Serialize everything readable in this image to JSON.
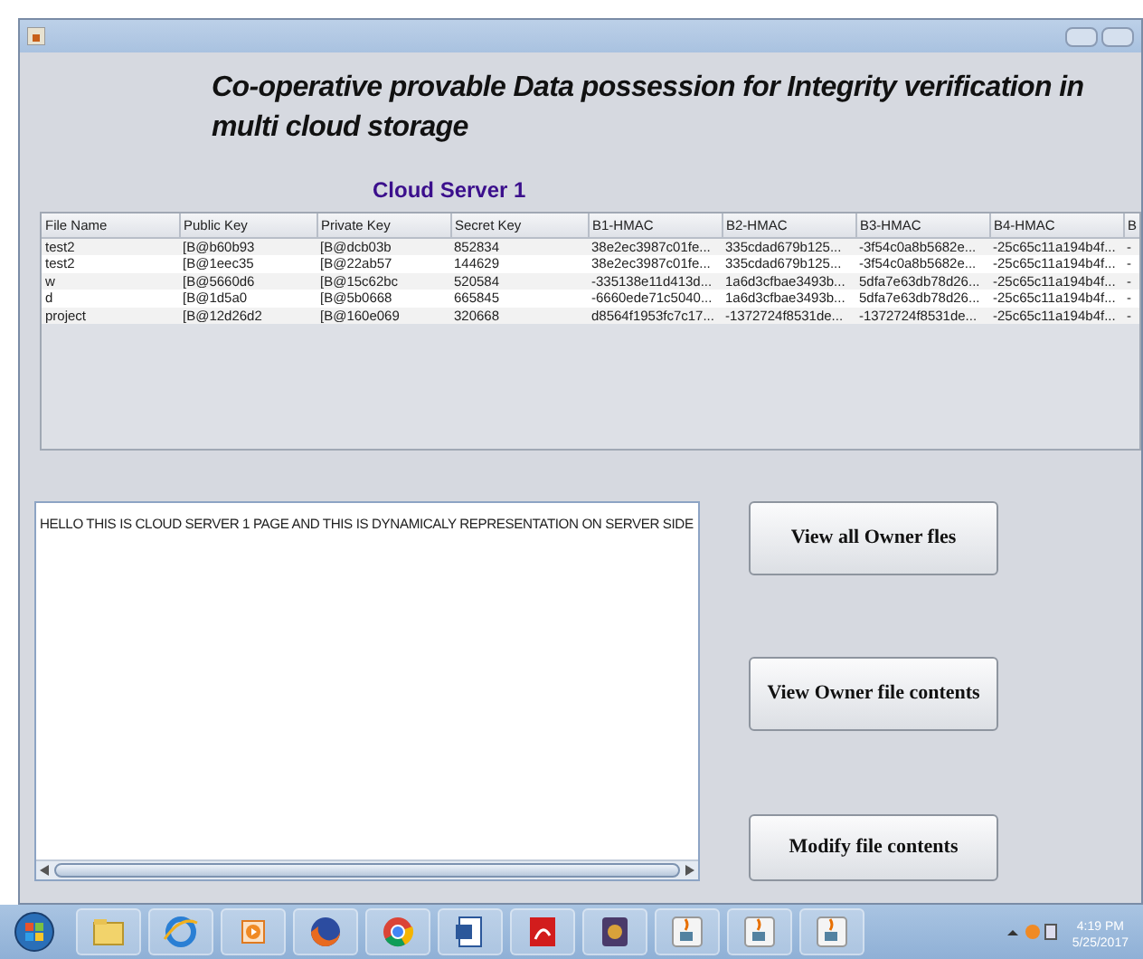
{
  "window": {
    "title_text": "Co-operative provable Data possession for Integrity verification in multi cloud storage"
  },
  "heading": "Cloud Server 1",
  "table": {
    "columns": [
      "File Name",
      "Public Key",
      "Private Key",
      "Secret Key",
      "B1-HMAC",
      "B2-HMAC",
      "B3-HMAC",
      "B4-HMAC",
      "B"
    ],
    "rows": [
      [
        "test2",
        "[B@b60b93",
        "[B@dcb03b",
        "852834",
        "38e2ec3987c01fe...",
        "335cdad679b125...",
        "-3f54c0a8b5682e...",
        "-25c65c11a194b4f...",
        "-"
      ],
      [
        "test2",
        "[B@1eec35",
        "[B@22ab57",
        "144629",
        "38e2ec3987c01fe...",
        "335cdad679b125...",
        "-3f54c0a8b5682e...",
        "-25c65c11a194b4f...",
        "-"
      ],
      [
        "w",
        "[B@5660d6",
        "[B@15c62bc",
        "520584",
        "-335138e11d413d...",
        "1a6d3cfbae3493b...",
        "5dfa7e63db78d26...",
        "-25c65c11a194b4f...",
        "-"
      ],
      [
        "d",
        "[B@1d5a0",
        "[B@5b0668",
        "665845",
        "-6660ede71c5040...",
        "1a6d3cfbae3493b...",
        "5dfa7e63db78d26...",
        "-25c65c11a194b4f...",
        "-"
      ],
      [
        "project",
        "[B@12d26d2",
        "[B@160e069",
        "320668",
        "d8564f1953fc7c17...",
        "-1372724f8531de...",
        "-1372724f8531de...",
        "-25c65c11a194b4f...",
        "-"
      ]
    ]
  },
  "text_area": {
    "value": "HELLO THIS IS CLOUD SERVER 1 PAGE AND THIS IS DYNAMICALY REPRESENTATION ON SERVER SIDE"
  },
  "buttons": [
    "View all Owner fles",
    "View Owner file contents",
    "Modify file contents"
  ],
  "taskbar": {
    "apps": [
      {
        "kind": "folder"
      },
      {
        "kind": "ie"
      },
      {
        "kind": "media"
      },
      {
        "kind": "firefox"
      },
      {
        "kind": "chrome"
      },
      {
        "kind": "word"
      },
      {
        "kind": "pdf"
      },
      {
        "kind": "game"
      },
      {
        "kind": "java"
      },
      {
        "kind": "java"
      },
      {
        "kind": "java"
      }
    ],
    "time": "4:19 PM",
    "date": "5/25/2017"
  }
}
